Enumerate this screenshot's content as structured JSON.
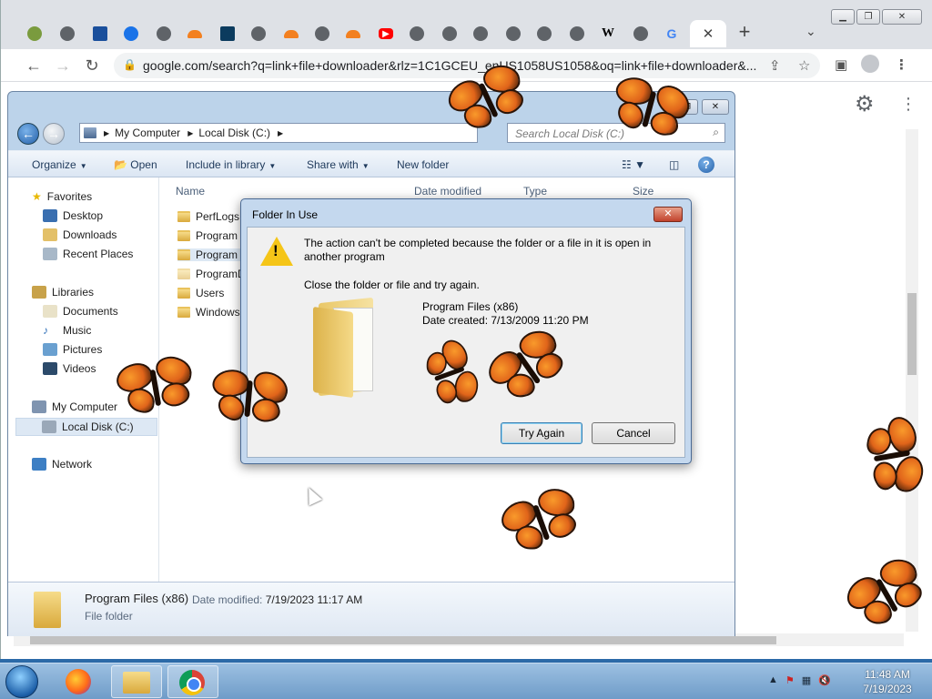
{
  "chrome": {
    "url": "google.com/search?q=link+file+downloader&rlz=1C1GCEU_enUS1058US1058&oq=link+file+downloader&...",
    "tabs_favicons": [
      "extension-icon",
      "globe-icon",
      "site-icon",
      "settings-icon",
      "globe-icon",
      "cloudflare-icon",
      "site-icon",
      "globe-icon",
      "cloudflare-icon",
      "globe-icon",
      "cloudflare-icon",
      "youtube-icon",
      "chrome-icon",
      "chrome-icon",
      "chrome-icon",
      "chrome-icon",
      "chrome-icon",
      "chrome-icon",
      "wikipedia-icon",
      "globe-icon",
      "google-icon"
    ],
    "wiki_letter": "W",
    "google_letter": "G",
    "new_tab": "+",
    "tab_close": "✕"
  },
  "explorer": {
    "breadcrumb": [
      "My Computer",
      "Local Disk (C:)"
    ],
    "search_placeholder": "Search Local Disk (C:)",
    "commands": {
      "organize": "Organize",
      "open": "Open",
      "include": "Include in library",
      "share": "Share with",
      "new_folder": "New folder"
    },
    "nav": {
      "favorites": "Favorites",
      "desktop": "Desktop",
      "downloads": "Downloads",
      "recent": "Recent Places",
      "libraries": "Libraries",
      "documents": "Documents",
      "music": "Music",
      "pictures": "Pictures",
      "videos": "Videos",
      "computer": "My Computer",
      "localdisk": "Local Disk (C:)",
      "network": "Network"
    },
    "columns": {
      "name": "Name",
      "date": "Date modified",
      "type": "Type",
      "size": "Size"
    },
    "files": [
      "PerfLogs",
      "Program Files",
      "Program Files (x86)",
      "ProgramData",
      "Users",
      "Windows"
    ],
    "details": {
      "name": "Program Files (x86)",
      "modified_label": "Date modified:",
      "modified_value": "7/19/2023 11:17 AM",
      "type": "File folder"
    }
  },
  "dialog": {
    "title": "Folder In Use",
    "close": "✕",
    "message": "The action can't be completed because the folder or a file in it is open in another program",
    "sub": "Close the folder or file and try again.",
    "item_name": "Program Files (x86)",
    "item_created": "Date created: 7/13/2009 11:20 PM",
    "try_again": "Try Again",
    "cancel": "Cancel"
  },
  "taskbar": {
    "time": "11:48 AM",
    "date": "7/19/2023"
  }
}
